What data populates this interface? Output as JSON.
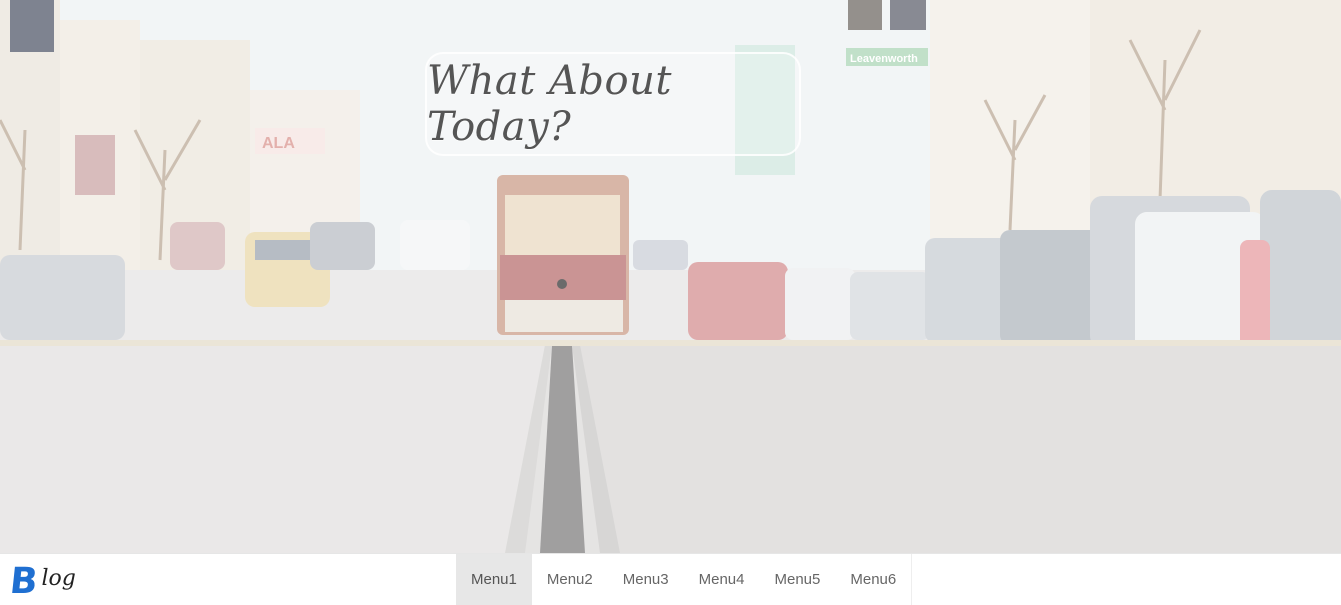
{
  "hero": {
    "title": "What About Today?",
    "street_sign": "Leavenworth",
    "billboard": "ALA"
  },
  "brand": {
    "letter": "B",
    "rest": "log",
    "color": "#1f6fd1"
  },
  "menu": {
    "active_index": 0,
    "items": [
      {
        "label": "Menu1"
      },
      {
        "label": "Menu2"
      },
      {
        "label": "Menu3"
      },
      {
        "label": "Menu4"
      },
      {
        "label": "Menu5"
      },
      {
        "label": "Menu6"
      }
    ]
  }
}
